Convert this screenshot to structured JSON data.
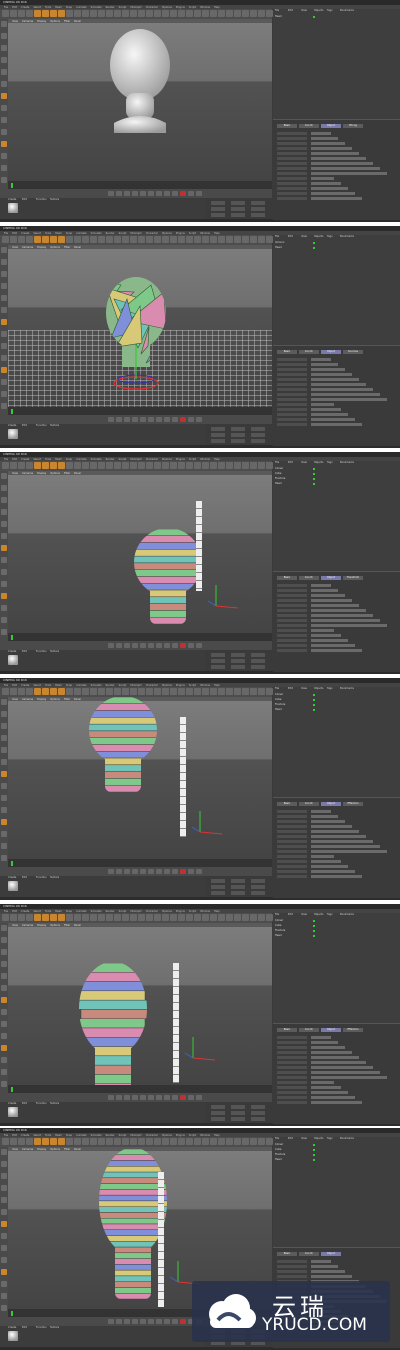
{
  "window": {
    "title": "CINEMA 4D R16"
  },
  "menu": [
    "File",
    "Edit",
    "Create",
    "Select",
    "Tools",
    "Mesh",
    "Snap",
    "Animate",
    "Simulate",
    "Render",
    "Sculpt",
    "MoGraph",
    "Character",
    "Pipeline",
    "Plugins",
    "Script",
    "Window",
    "Help"
  ],
  "viewport": {
    "menu": [
      "View",
      "Cameras",
      "Display",
      "Options",
      "Filter",
      "Panel"
    ]
  },
  "objects_menu": [
    "File",
    "Edit",
    "View",
    "Objects",
    "Tags",
    "Bookmarks"
  ],
  "material_menu": [
    "Create",
    "Edit",
    "Function",
    "Texture"
  ],
  "frames": [
    {
      "objects": [
        "Head"
      ],
      "attr_tabs": [
        "Basic",
        "Coord.",
        "Object",
        "Phong"
      ]
    },
    {
      "objects": [
        "Voronoi",
        "Head"
      ],
      "attr_tabs": [
        "Basic",
        "Coord.",
        "Object",
        "Sources"
      ]
    },
    {
      "objects": [
        "Cloner",
        "Cube",
        "Fracture",
        "Head"
      ],
      "attr_tabs": [
        "Basic",
        "Coord.",
        "Object",
        "Transform"
      ]
    },
    {
      "objects": [
        "Cloner",
        "Cube",
        "Fracture",
        "Head"
      ],
      "attr_tabs": [
        "Basic",
        "Coord.",
        "Object",
        "Effectors"
      ]
    },
    {
      "objects": [
        "Cloner",
        "Cube",
        "Fracture",
        "Head"
      ],
      "attr_tabs": [
        "Basic",
        "Coord.",
        "Object",
        "Effectors"
      ]
    },
    {
      "objects": [
        "Cloner",
        "Cube",
        "Fracture",
        "Head"
      ],
      "attr_tabs": [
        "Basic",
        "Coord.",
        "Object"
      ]
    }
  ],
  "watermark": {
    "cn": "云瑞",
    "en": "YRUCD.COM"
  },
  "colors": {
    "ui_dark": "#3a3a3a",
    "panel": "#4a4a4a",
    "slice_green": "#7ec98a",
    "slice_pink": "#d98bb0",
    "slice_blue": "#7f8fd9",
    "slice_yellow": "#d8c978",
    "slice_teal": "#6fc3b8"
  }
}
